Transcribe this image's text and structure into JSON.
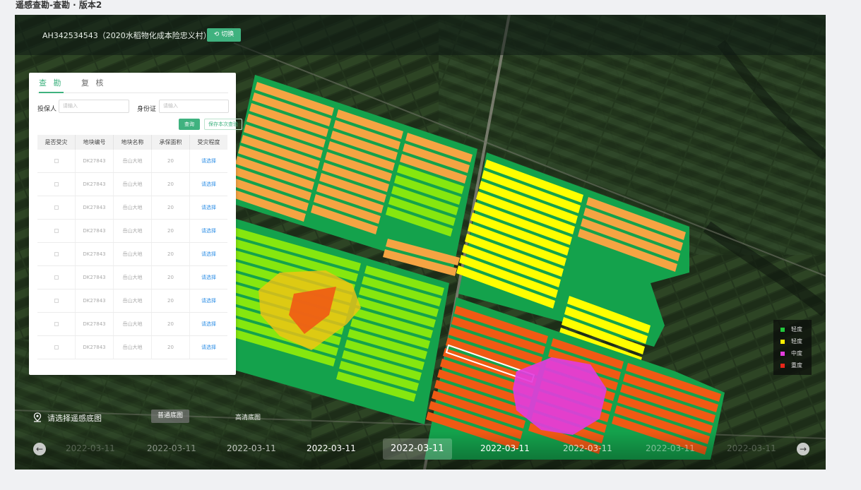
{
  "page": {
    "title": "遥感查勘-查勘 · 版本2"
  },
  "map": {
    "farm_title": "AH342534543（2020水稻物化成本险忠义村）",
    "switch_label": "切换"
  },
  "panel": {
    "tabs": [
      {
        "label": "查 勘"
      },
      {
        "label": "复 核"
      }
    ],
    "fields": {
      "insured_label": "投保人",
      "insured_placeholder": "请输入",
      "id_label": "身份证",
      "id_placeholder": "请输入"
    },
    "query_button": "查询",
    "save_button": "保存本次查验",
    "table": {
      "headers": [
        "是否受灾",
        "地块编号",
        "地块名称",
        "承保面积",
        "受灾程度"
      ],
      "rows": [
        {
          "code": "DK27843",
          "name": "岳山大地",
          "area": "20",
          "severity": "请选择"
        },
        {
          "code": "DK27843",
          "name": "岳山大地",
          "area": "20",
          "severity": "请选择"
        },
        {
          "code": "DK27843",
          "name": "岳山大地",
          "area": "20",
          "severity": "请选择"
        },
        {
          "code": "DK27843",
          "name": "岳山大地",
          "area": "20",
          "severity": "请选择"
        },
        {
          "code": "DK27843",
          "name": "岳山大地",
          "area": "20",
          "severity": "请选择"
        },
        {
          "code": "DK27843",
          "name": "岳山大地",
          "area": "20",
          "severity": "请选择"
        },
        {
          "code": "DK27843",
          "name": "岳山大地",
          "area": "20",
          "severity": "请选择"
        },
        {
          "code": "DK27843",
          "name": "岳山大地",
          "area": "20",
          "severity": "请选择"
        },
        {
          "code": "DK27843",
          "name": "岳山大地",
          "area": "20",
          "severity": "请选择"
        }
      ]
    }
  },
  "legend": [
    {
      "label": "轻度",
      "color": "#22c83c"
    },
    {
      "label": "轻度",
      "color": "#ffee00"
    },
    {
      "label": "中度",
      "color": "#e23ddc"
    },
    {
      "label": "重度",
      "color": "#e8261a"
    }
  ],
  "basemap": {
    "label": "请选择遥感底图",
    "normal": "普通底图",
    "hd": "高清底图"
  },
  "timeline": {
    "dates": [
      "2022-03-11",
      "2022-03-11",
      "2022-03-11",
      "2022-03-11",
      "2022-03-11",
      "2022-03-11",
      "2022-03-11",
      "2022-03-11",
      "2022-03-11"
    ],
    "active_index": 4
  },
  "colors": {
    "accent": "#3fb27f",
    "field_orange": "#f5a443",
    "field_yellow": "#ffff00",
    "field_lime": "#86e70f",
    "field_red": "#f05a14",
    "field_border": "#14a24c"
  }
}
